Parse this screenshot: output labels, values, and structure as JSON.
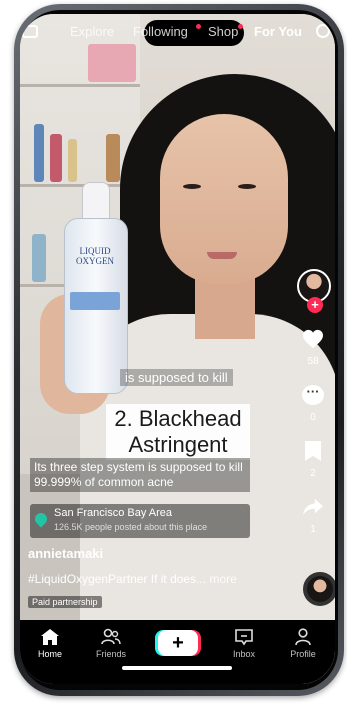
{
  "top_tabs": [
    {
      "label": "Explore"
    },
    {
      "label": "Following"
    },
    {
      "label": "Shop"
    },
    {
      "label": "For You"
    }
  ],
  "video": {
    "caption_small": "is supposed to kill",
    "caption_big": "2. Blackhead Astringent",
    "bottle_brand": "LIQUID OXYGEN"
  },
  "description": "Its three step system is supposed to kill 99.999% of common acne",
  "location": {
    "name": "San Francisco Bay Area",
    "sub": "126.5K people posted about this place"
  },
  "username": "annietamaki",
  "post_text": "#LiquidOxygenPartner If it does...",
  "more_label": "more",
  "paid_label": "Paid partnership",
  "actions": {
    "likes": "58",
    "comments": "0",
    "saves": "2",
    "shares": "1",
    "follow_symbol": "+"
  },
  "nav": {
    "home": "Home",
    "friends": "Friends",
    "create_symbol": "+",
    "inbox": "Inbox",
    "profile": "Profile"
  },
  "colors": {
    "accent_red": "#fe2c55",
    "accent_cyan": "#25f4ee",
    "location_green": "#23c4a6"
  }
}
